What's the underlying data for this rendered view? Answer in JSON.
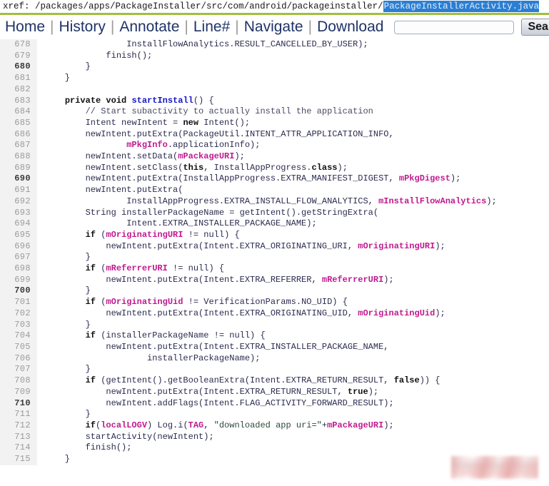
{
  "xref": {
    "label": "xref: ",
    "path": "/packages/apps/PackageInstaller/src/com/android/packageinstaller/",
    "file": "PackageInstallerActivity.java"
  },
  "nav": {
    "links": [
      {
        "label": "Home"
      },
      {
        "label": "History"
      },
      {
        "label": "Annotate"
      },
      {
        "label": "Line#"
      },
      {
        "label": "Navigate"
      },
      {
        "label": "Download"
      }
    ],
    "separator": "|",
    "search": {
      "value": "",
      "placeholder": ""
    },
    "search_button": "Search"
  },
  "colors": {
    "accent_green": "#9fbf3b",
    "selection_blue": "#2a7fd4",
    "nav_link": "#1f3368",
    "line_number": "#9b9b9b",
    "gutter_bg": "#f2f2f2",
    "code_text": "#2b2b4f",
    "token_keyword": "#101010",
    "token_definition": "#1414c8",
    "token_variable": "#c01a8f",
    "token_string": "#2d4a3a",
    "token_comment": "#4a4a63"
  },
  "code": {
    "first_line": 678,
    "last_line": 715,
    "bold_line_numbers": [
      680,
      690,
      700,
      710
    ],
    "lines": [
      {
        "n": 678,
        "tokens": [
          {
            "t": "plain",
            "s": "                InstallFlowAnalytics.RESULT_CANCELLED_BY_USER);"
          }
        ]
      },
      {
        "n": 679,
        "tokens": [
          {
            "t": "plain",
            "s": "            finish();"
          }
        ]
      },
      {
        "n": 680,
        "tokens": [
          {
            "t": "plain",
            "s": "        }"
          }
        ]
      },
      {
        "n": 681,
        "tokens": [
          {
            "t": "plain",
            "s": "    }"
          }
        ]
      },
      {
        "n": 682,
        "tokens": [
          {
            "t": "plain",
            "s": ""
          }
        ]
      },
      {
        "n": 683,
        "tokens": [
          {
            "t": "plain",
            "s": "    "
          },
          {
            "t": "kw",
            "s": "private void "
          },
          {
            "t": "def",
            "s": "startInstall"
          },
          {
            "t": "plain",
            "s": "() {"
          }
        ]
      },
      {
        "n": 684,
        "tokens": [
          {
            "t": "plain",
            "s": "        "
          },
          {
            "t": "cmt",
            "s": "// Start subactivity to actually install the application"
          }
        ]
      },
      {
        "n": 685,
        "tokens": [
          {
            "t": "plain",
            "s": "        Intent newIntent = "
          },
          {
            "t": "kw",
            "s": "new"
          },
          {
            "t": "plain",
            "s": " Intent();"
          }
        ]
      },
      {
        "n": 686,
        "tokens": [
          {
            "t": "plain",
            "s": "        newIntent.putExtra(PackageUtil.INTENT_ATTR_APPLICATION_INFO,"
          }
        ]
      },
      {
        "n": 687,
        "tokens": [
          {
            "t": "plain",
            "s": "                "
          },
          {
            "t": "var",
            "s": "mPkgInfo"
          },
          {
            "t": "plain",
            "s": ".applicationInfo);"
          }
        ]
      },
      {
        "n": 688,
        "tokens": [
          {
            "t": "plain",
            "s": "        newIntent.setData("
          },
          {
            "t": "var",
            "s": "mPackageURI"
          },
          {
            "t": "plain",
            "s": ");"
          }
        ]
      },
      {
        "n": 689,
        "tokens": [
          {
            "t": "plain",
            "s": "        newIntent.setClass("
          },
          {
            "t": "kw",
            "s": "this"
          },
          {
            "t": "plain",
            "s": ", InstallAppProgress."
          },
          {
            "t": "kw",
            "s": "class"
          },
          {
            "t": "plain",
            "s": ");"
          }
        ]
      },
      {
        "n": 690,
        "tokens": [
          {
            "t": "plain",
            "s": "        newIntent.putExtra(InstallAppProgress.EXTRA_MANIFEST_DIGEST, "
          },
          {
            "t": "var",
            "s": "mPkgDigest"
          },
          {
            "t": "plain",
            "s": ");"
          }
        ]
      },
      {
        "n": 691,
        "tokens": [
          {
            "t": "plain",
            "s": "        newIntent.putExtra("
          }
        ]
      },
      {
        "n": 692,
        "tokens": [
          {
            "t": "plain",
            "s": "                InstallAppProgress.EXTRA_INSTALL_FLOW_ANALYTICS, "
          },
          {
            "t": "var",
            "s": "mInstallFlowAnalytics"
          },
          {
            "t": "plain",
            "s": ");"
          }
        ]
      },
      {
        "n": 693,
        "tokens": [
          {
            "t": "plain",
            "s": "        String installerPackageName = getIntent().getStringExtra("
          }
        ]
      },
      {
        "n": 694,
        "tokens": [
          {
            "t": "plain",
            "s": "                Intent.EXTRA_INSTALLER_PACKAGE_NAME);"
          }
        ]
      },
      {
        "n": 695,
        "tokens": [
          {
            "t": "plain",
            "s": "        "
          },
          {
            "t": "kw",
            "s": "if"
          },
          {
            "t": "plain",
            "s": " ("
          },
          {
            "t": "var",
            "s": "mOriginatingURI"
          },
          {
            "t": "plain",
            "s": " != null) {"
          }
        ]
      },
      {
        "n": 696,
        "tokens": [
          {
            "t": "plain",
            "s": "            newIntent.putExtra(Intent.EXTRA_ORIGINATING_URI, "
          },
          {
            "t": "var",
            "s": "mOriginatingURI"
          },
          {
            "t": "plain",
            "s": ");"
          }
        ]
      },
      {
        "n": 697,
        "tokens": [
          {
            "t": "plain",
            "s": "        }"
          }
        ]
      },
      {
        "n": 698,
        "tokens": [
          {
            "t": "plain",
            "s": "        "
          },
          {
            "t": "kw",
            "s": "if"
          },
          {
            "t": "plain",
            "s": " ("
          },
          {
            "t": "var",
            "s": "mReferrerURI"
          },
          {
            "t": "plain",
            "s": " != null) {"
          }
        ]
      },
      {
        "n": 699,
        "tokens": [
          {
            "t": "plain",
            "s": "            newIntent.putExtra(Intent.EXTRA_REFERRER, "
          },
          {
            "t": "var",
            "s": "mReferrerURI"
          },
          {
            "t": "plain",
            "s": ");"
          }
        ]
      },
      {
        "n": 700,
        "tokens": [
          {
            "t": "plain",
            "s": "        }"
          }
        ]
      },
      {
        "n": 701,
        "tokens": [
          {
            "t": "plain",
            "s": "        "
          },
          {
            "t": "kw",
            "s": "if"
          },
          {
            "t": "plain",
            "s": " ("
          },
          {
            "t": "var",
            "s": "mOriginatingUid"
          },
          {
            "t": "plain",
            "s": " != VerificationParams.NO_UID) {"
          }
        ]
      },
      {
        "n": 702,
        "tokens": [
          {
            "t": "plain",
            "s": "            newIntent.putExtra(Intent.EXTRA_ORIGINATING_UID, "
          },
          {
            "t": "var",
            "s": "mOriginatingUid"
          },
          {
            "t": "plain",
            "s": ");"
          }
        ]
      },
      {
        "n": 703,
        "tokens": [
          {
            "t": "plain",
            "s": "        }"
          }
        ]
      },
      {
        "n": 704,
        "tokens": [
          {
            "t": "plain",
            "s": "        "
          },
          {
            "t": "kw",
            "s": "if"
          },
          {
            "t": "plain",
            "s": " (installerPackageName != null) {"
          }
        ]
      },
      {
        "n": 705,
        "tokens": [
          {
            "t": "plain",
            "s": "            newIntent.putExtra(Intent.EXTRA_INSTALLER_PACKAGE_NAME,"
          }
        ]
      },
      {
        "n": 706,
        "tokens": [
          {
            "t": "plain",
            "s": "                    installerPackageName);"
          }
        ]
      },
      {
        "n": 707,
        "tokens": [
          {
            "t": "plain",
            "s": "        }"
          }
        ]
      },
      {
        "n": 708,
        "tokens": [
          {
            "t": "plain",
            "s": "        "
          },
          {
            "t": "kw",
            "s": "if"
          },
          {
            "t": "plain",
            "s": " (getIntent().getBooleanExtra(Intent.EXTRA_RETURN_RESULT, "
          },
          {
            "t": "kw",
            "s": "false"
          },
          {
            "t": "plain",
            "s": ")) {"
          }
        ]
      },
      {
        "n": 709,
        "tokens": [
          {
            "t": "plain",
            "s": "            newIntent.putExtra(Intent.EXTRA_RETURN_RESULT, "
          },
          {
            "t": "kw",
            "s": "true"
          },
          {
            "t": "plain",
            "s": ");"
          }
        ]
      },
      {
        "n": 710,
        "tokens": [
          {
            "t": "plain",
            "s": "            newIntent.addFlags(Intent.FLAG_ACTIVITY_FORWARD_RESULT);"
          }
        ]
      },
      {
        "n": 711,
        "tokens": [
          {
            "t": "plain",
            "s": "        }"
          }
        ]
      },
      {
        "n": 712,
        "tokens": [
          {
            "t": "plain",
            "s": "        "
          },
          {
            "t": "kw",
            "s": "if"
          },
          {
            "t": "plain",
            "s": "("
          },
          {
            "t": "var",
            "s": "localLOGV"
          },
          {
            "t": "plain",
            "s": ") Log.i("
          },
          {
            "t": "var",
            "s": "TAG"
          },
          {
            "t": "plain",
            "s": ", "
          },
          {
            "t": "str",
            "s": "\"downloaded app uri=\""
          },
          {
            "t": "plain",
            "s": "+"
          },
          {
            "t": "var",
            "s": "mPackageURI"
          },
          {
            "t": "plain",
            "s": ");"
          }
        ]
      },
      {
        "n": 713,
        "tokens": [
          {
            "t": "plain",
            "s": "        startActivity(newIntent);"
          }
        ]
      },
      {
        "n": 714,
        "tokens": [
          {
            "t": "plain",
            "s": "        finish();"
          }
        ]
      },
      {
        "n": 715,
        "tokens": [
          {
            "t": "plain",
            "s": "    }"
          }
        ]
      }
    ]
  }
}
